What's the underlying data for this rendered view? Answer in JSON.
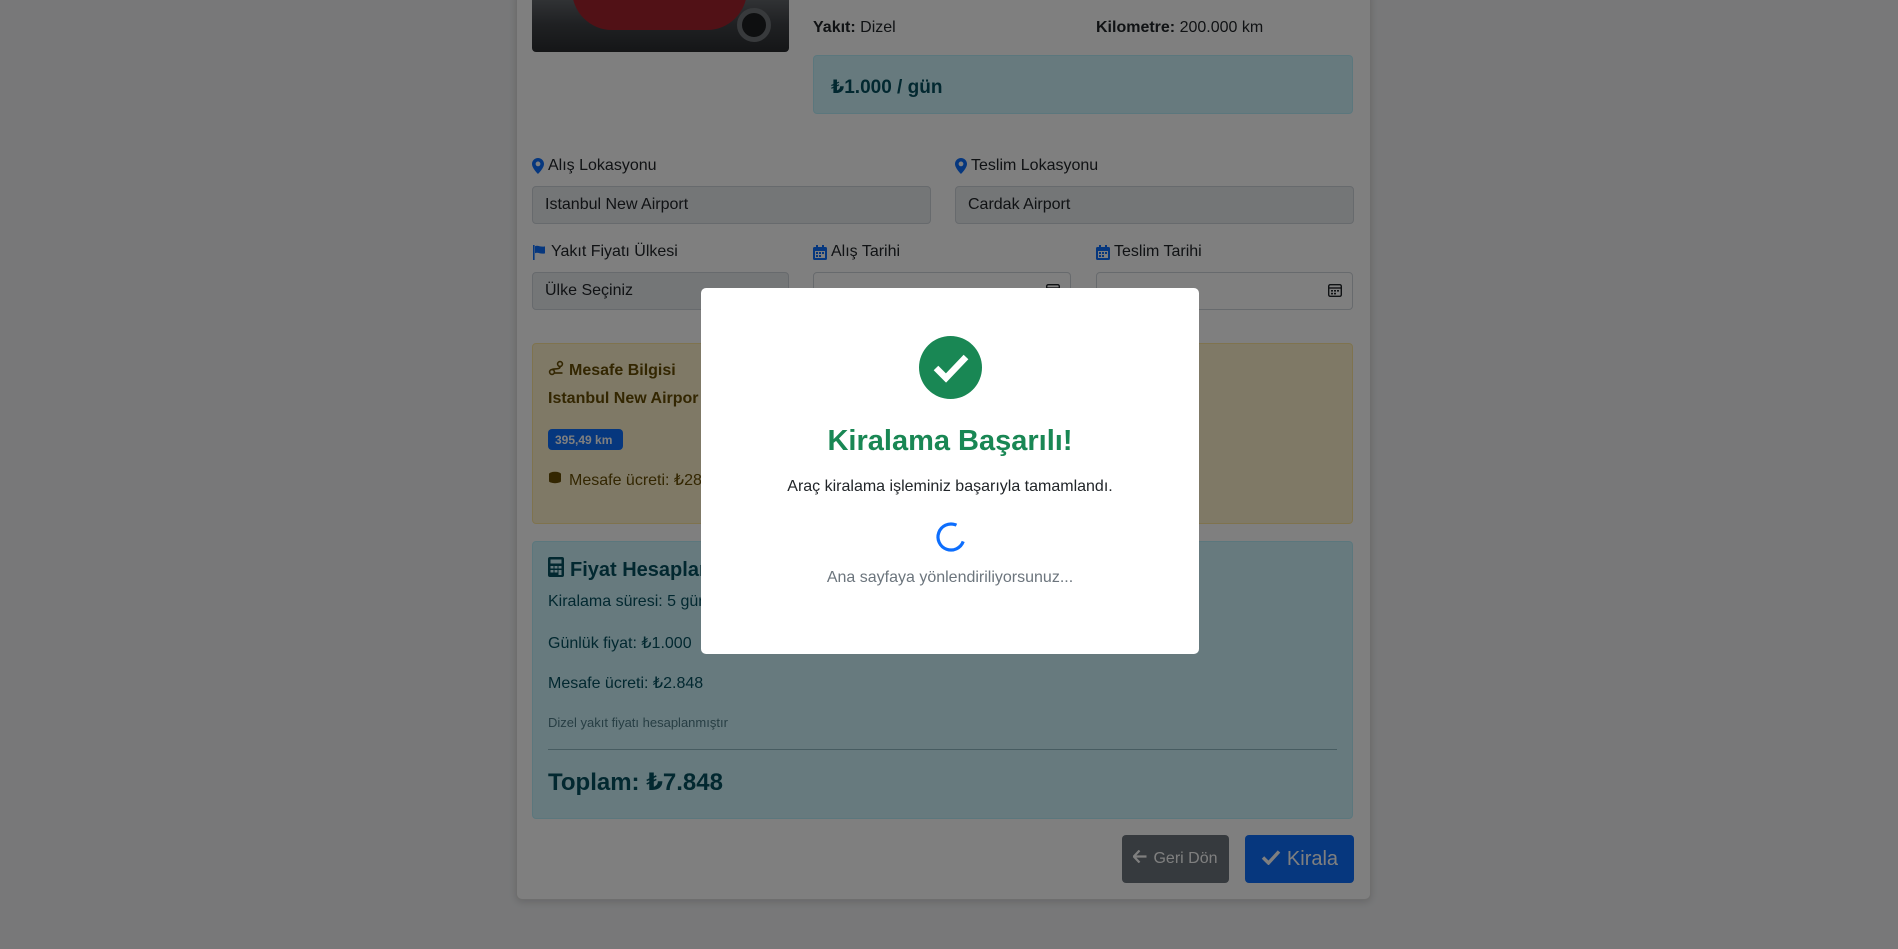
{
  "vehicle": {
    "fuel_label": "Yakıt:",
    "fuel_value": "Dizel",
    "km_label": "Kilometre:",
    "km_value": "200.000 km",
    "daily_price": "₺1.000 / gün"
  },
  "form": {
    "pickup_location_label": "Alış Lokasyonu",
    "pickup_location_value": "Istanbul New Airport",
    "return_location_label": "Teslim Lokasyonu",
    "return_location_value": "Cardak Airport",
    "fuel_country_label": "Yakıt Fiyatı Ülkesi",
    "fuel_country_value": "Ülke Seçiniz",
    "pickup_date_label": "Alış Tarihi",
    "return_date_label": "Teslim Tarihi"
  },
  "distance": {
    "title": "Mesafe Bilgisi",
    "route": "Istanbul New Airpor",
    "km_badge": "395,49 km",
    "fee_text": "Mesafe ücreti: ₺284"
  },
  "calculation": {
    "title": "Fiyat Hesaplan",
    "duration": "Kiralama süresi: 5 gün",
    "daily": "Günlük fiyat: ₺1.000",
    "distance_fee": "Mesafe ücreti: ₺2.848",
    "fuel_note": "Dizel yakıt fiyatı hesaplanmıştır",
    "total": "Toplam: ₺7.848"
  },
  "buttons": {
    "back_label": "Geri Dön",
    "rent_label": "Kirala"
  },
  "modal": {
    "title": "Kiralama Başarılı!",
    "message": "Araç kiralama işleminiz başarıyla tamamlandı.",
    "redirect": "Ana sayfaya yönlendiriliyorsunuz..."
  },
  "colors": {
    "primary": "#0d6efd",
    "success": "#198754",
    "info_bg": "#cff4fc",
    "warning_bg": "#fff3cd",
    "secondary": "#6c757d"
  },
  "icons": {
    "location": "map-marker-icon",
    "flag": "flag-icon",
    "calendar": "calendar-icon",
    "route": "route-icon",
    "coins": "coins-icon",
    "calculator": "calculator-icon",
    "check": "check-circle-icon",
    "arrow_left": "arrow-left-icon"
  }
}
